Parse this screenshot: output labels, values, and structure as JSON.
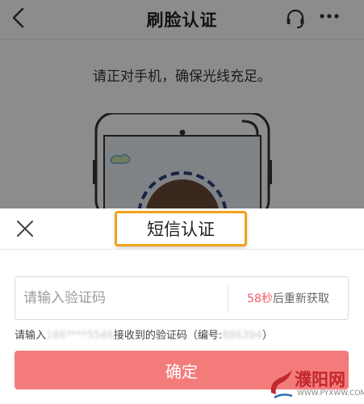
{
  "navbar": {
    "title": "刷脸认证",
    "icons": [
      "back-arrow-icon",
      "headset-icon",
      "more-icon"
    ]
  },
  "instruction": "请正对手机，确保光线充足。",
  "sheet": {
    "title": "短信认证",
    "code_input": {
      "placeholder": "请输入验证码",
      "value": ""
    },
    "resend": {
      "countdown": "58秒",
      "label": "后重新获取"
    },
    "hint": {
      "prefix": "请输入",
      "phone_masked": "186****5546",
      "middle": "接收到的验证码（编号:",
      "serial_masked": "886394",
      "suffix": "）"
    },
    "confirm_label": "确定"
  },
  "watermark": {
    "text": "濮阳网",
    "url": "WWW.PYXWW.COM"
  },
  "colors": {
    "accent_red": "#f37c7b",
    "countdown_red": "#ef5d66",
    "highlight_orange": "#f0a21a",
    "watermark_red": "#c1272d"
  }
}
